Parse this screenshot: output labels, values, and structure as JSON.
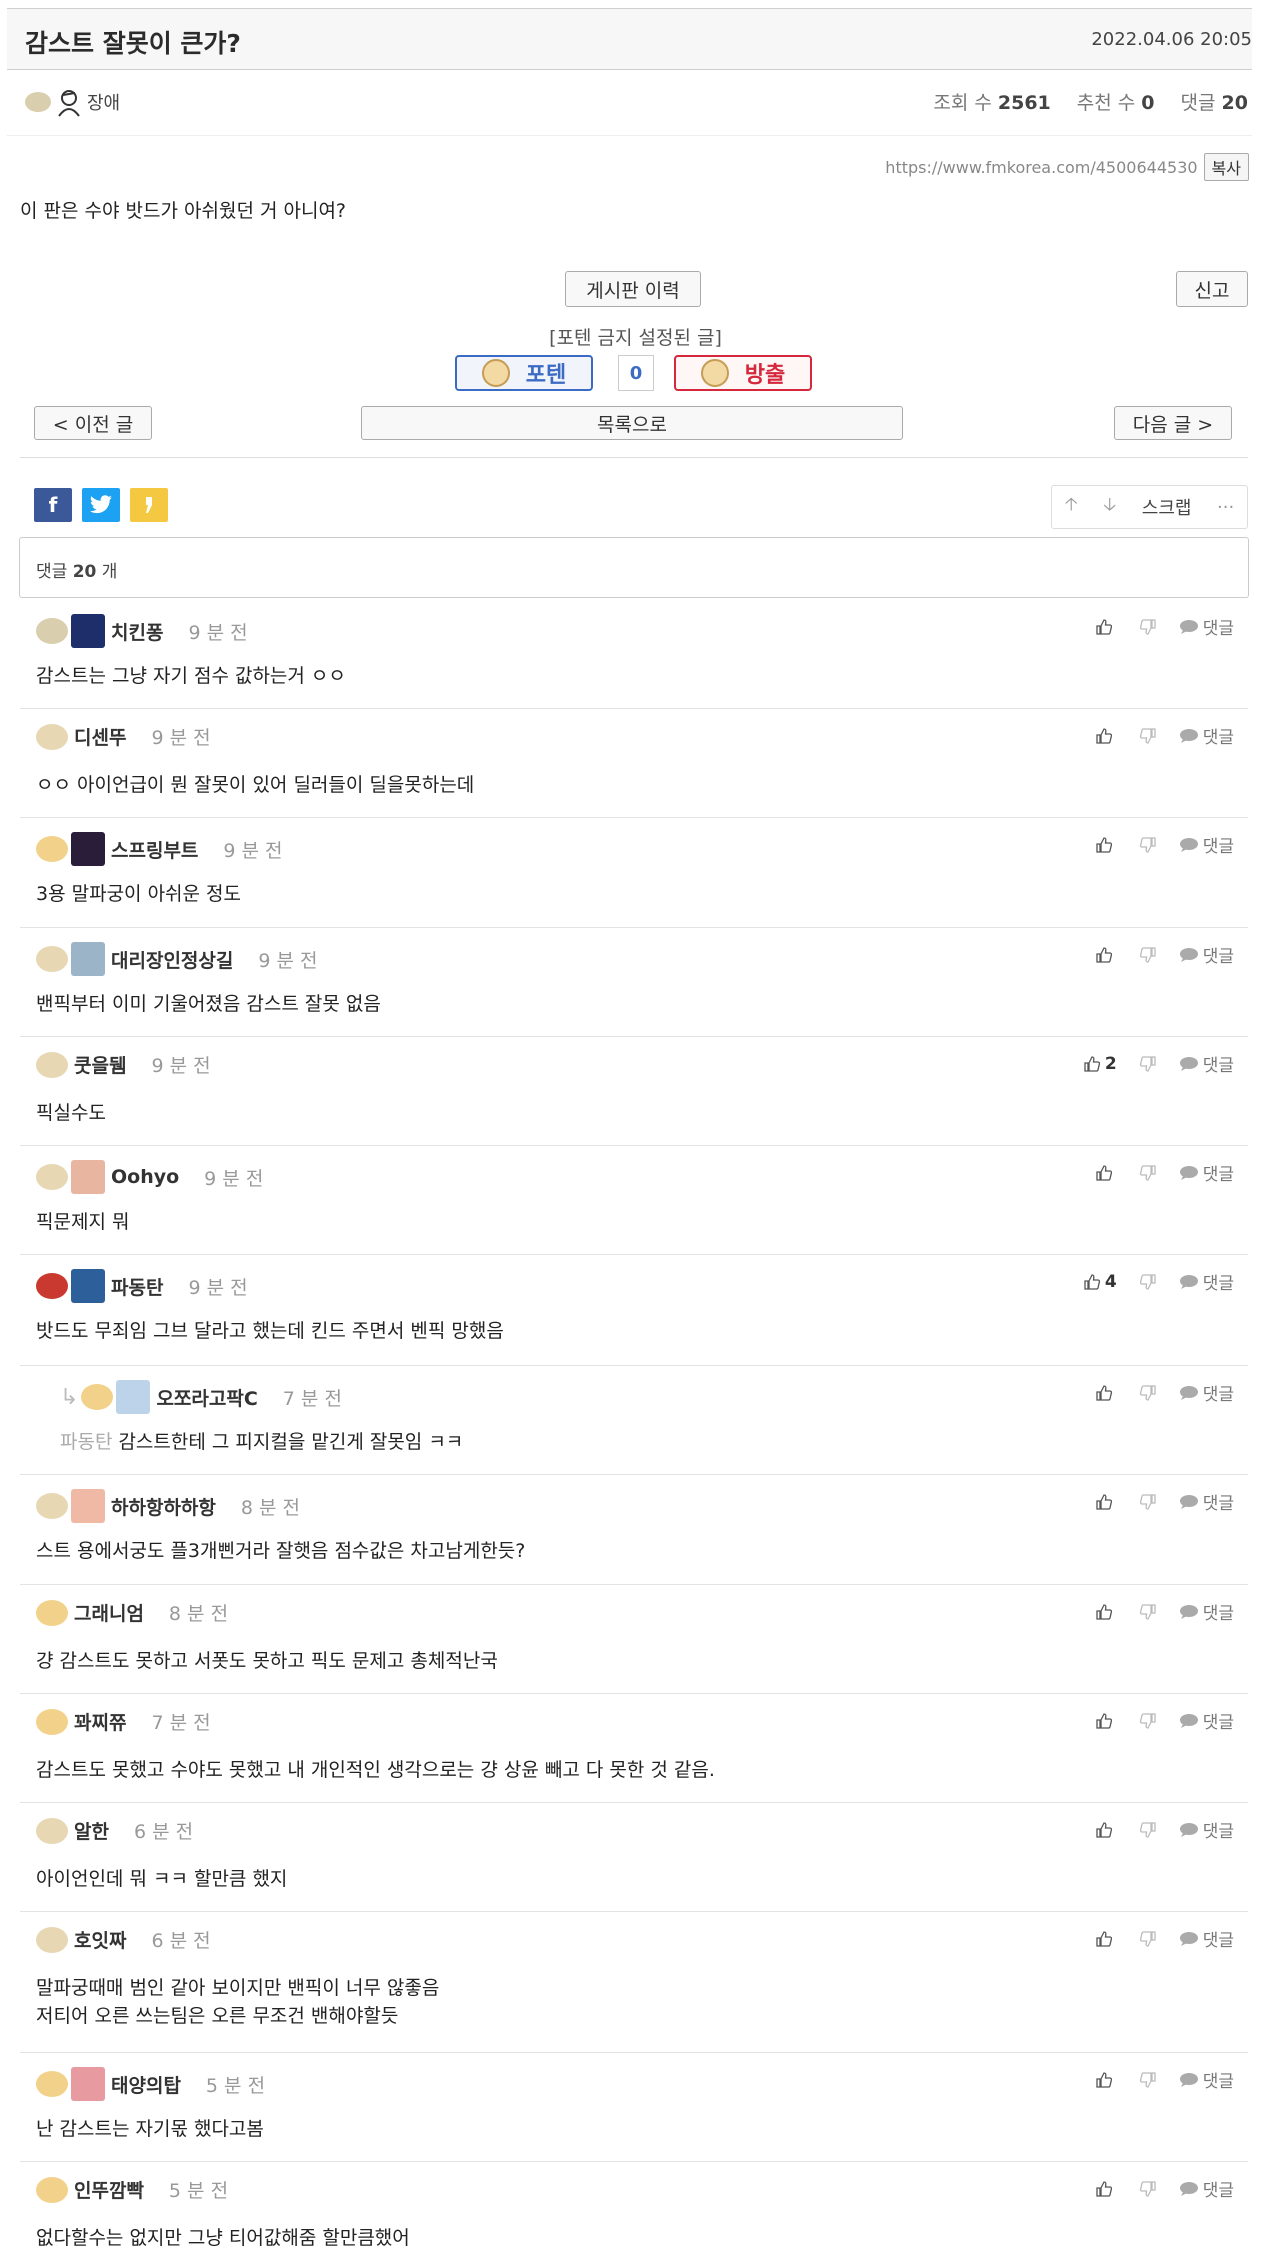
{
  "post": {
    "title": "감스트 잘못이 큰가?",
    "date": "2022.04.06 20:05",
    "author": "장애",
    "views_label": "조회 수",
    "views": "2561",
    "recommend_label": "추천 수",
    "recommend": "0",
    "comments_label": "댓글",
    "comments": "20",
    "url": "https://www.fmkorea.com/4500644530",
    "copy_label": "복사",
    "body": "이 판은 수야 밧드가 아쉬웠던 거 아니여?"
  },
  "buttons": {
    "history": "게시판 이력",
    "report": "신고",
    "notice": "[포텐 금지 설정된 글]",
    "poten": "포텐",
    "vote_count": "0",
    "banish": "방출",
    "prev": "< 이전 글",
    "list": "목록으로",
    "next": "다음 글 >",
    "scrap": "스크랩",
    "more": "···"
  },
  "comment_header": {
    "label": "댓글",
    "count": "20",
    "unit": "개"
  },
  "reply_label": "댓글",
  "comments": [
    {
      "user": "치킨퐁",
      "time": "9 분 전",
      "text": "감스트는 그냥 자기 점수 값하는거 ㅇㅇ",
      "likes": ""
    },
    {
      "user": "디센뚜",
      "time": "9 분 전",
      "text": "ㅇㅇ 아이언급이 뭔 잘못이 있어 딜러들이 딜을못하는데",
      "likes": ""
    },
    {
      "user": "스프링부트",
      "time": "9 분 전",
      "text": "3용 말파궁이 아쉬운 정도",
      "likes": ""
    },
    {
      "user": "대리장인정상길",
      "time": "9 분 전",
      "text": "밴픽부터 이미 기울어졌음 감스트 잘못 없음",
      "likes": ""
    },
    {
      "user": "쿳을뒘",
      "time": "9 분 전",
      "text": "픽실수도",
      "likes": "2"
    },
    {
      "user": "Oohyo",
      "time": "9 분 전",
      "text": "픽문제지 뭐",
      "likes": ""
    },
    {
      "user": "파동탄",
      "time": "9 분 전",
      "text": "밧드도 무죄임 그브 달라고 했는데 킨드 주면서 벤픽 망했음",
      "likes": "4"
    },
    {
      "user": "오쪼라고팍C",
      "time": "7 분 전",
      "reply_to": "파동탄",
      "text": "감스트한테 그 피지컬을 맡긴게 잘못임 ㅋㅋ",
      "likes": ""
    },
    {
      "user": "하하항하하항",
      "time": "8 분 전",
      "text": "스트 용에서궁도 플3개삔거라 잘햇음 점수값은 차고남게한듯?",
      "likes": ""
    },
    {
      "user": "그래니엄",
      "time": "8 분 전",
      "text": "걍 감스트도 못하고 서폿도 못하고 픽도 문제고 총체적난국",
      "likes": ""
    },
    {
      "user": "꽈찌쮸",
      "time": "7 분 전",
      "text": "감스트도 못했고 수야도 못했고 내 개인적인 생각으로는 걍 상윤 빼고 다 못한 것 같음.",
      "likes": ""
    },
    {
      "user": "알한",
      "time": "6 분 전",
      "text": "아이언인데 뭐 ㅋㅋ 할만큼 했지",
      "likes": ""
    },
    {
      "user": "호잇짜",
      "time": "6 분 전",
      "text": "말파궁때매 범인 같아 보이지만 밴픽이 너무 않좋음",
      "text2": "저티어 오른 쓰는팀은 오른 무조건 밴해야할듯",
      "likes": ""
    },
    {
      "user": "태양의탑",
      "time": "5 분 전",
      "text": "난 감스트는 자기몫 했다고봄",
      "likes": ""
    },
    {
      "user": "인뚜깜빡",
      "time": "5 분 전",
      "text": "없다할수는 없지만 그냥 티어값해줌 할만큼했어",
      "likes": ""
    }
  ],
  "colors": {
    "poten": "#3b6bc3",
    "banish": "#d6283c",
    "facebook": "#3b5998",
    "twitter": "#1da1f2",
    "kakao": "#f5c842"
  }
}
